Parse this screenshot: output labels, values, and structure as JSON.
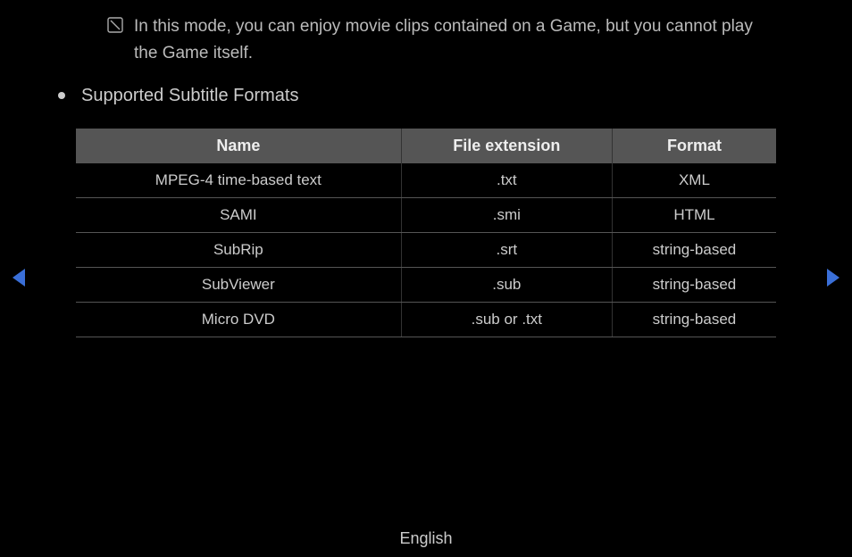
{
  "note": {
    "text": "In this mode, you can enjoy movie clips contained on a Game, but you cannot play the Game itself."
  },
  "section": {
    "title": "Supported Subtitle Formats"
  },
  "table": {
    "headers": {
      "name": "Name",
      "extension": "File extension",
      "format": "Format"
    },
    "rows": [
      {
        "name": "MPEG-4 time-based text",
        "extension": ".txt",
        "format": "XML"
      },
      {
        "name": "SAMI",
        "extension": ".smi",
        "format": "HTML"
      },
      {
        "name": "SubRip",
        "extension": ".srt",
        "format": "string-based"
      },
      {
        "name": "SubViewer",
        "extension": ".sub",
        "format": "string-based"
      },
      {
        "name": "Micro DVD",
        "extension": ".sub or .txt",
        "format": "string-based"
      }
    ]
  },
  "footer": {
    "language": "English"
  }
}
